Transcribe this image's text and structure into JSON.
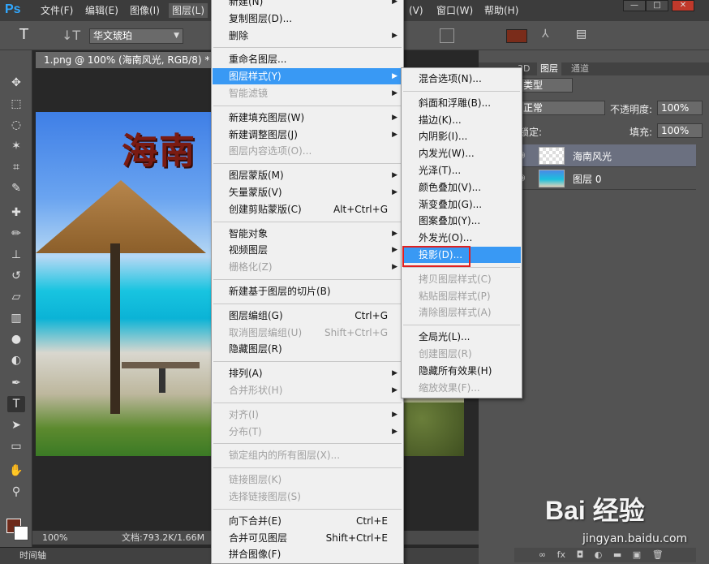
{
  "app": {
    "logo": "Ps"
  },
  "menubar": {
    "items": [
      "文件(F)",
      "编辑(E)",
      "图像(I)",
      "图层(L)",
      "(V)",
      "窗口(W)",
      "帮助(H)"
    ],
    "window_controls": [
      "—",
      "□",
      "✕"
    ]
  },
  "options": {
    "font": "华文琥珀",
    "color_swatch": "#7a2c1a"
  },
  "document": {
    "tab": "1.png @ 100% (海南风光, RGB/8) *",
    "canvas_text": "海南",
    "zoom": "100%",
    "doc_size": "文档:793.2K/1.66M"
  },
  "timeline": {
    "label": "时间轴"
  },
  "layers_panel": {
    "tabs": [
      "3D",
      "图层",
      "通道"
    ],
    "filter_type": "类型",
    "blend_mode": "正常",
    "opacity_label": "不透明度:",
    "opacity_value": "100%",
    "lock_label": "锁定:",
    "fill_label": "填充:",
    "fill_value": "100%",
    "layers": [
      {
        "name": "海南风光",
        "selected": true
      },
      {
        "name": "图层 0",
        "selected": false
      }
    ],
    "bottom_icons": [
      "∞",
      "fx",
      "◘",
      "◐",
      "▬",
      "▣",
      "🗑"
    ]
  },
  "layer_menu": {
    "items": [
      {
        "label": "新建(N)",
        "arrow": true,
        "disabled": false
      },
      {
        "label": "复制图层(D)...",
        "disabled": false
      },
      {
        "label": "删除",
        "arrow": true,
        "disabled": false
      },
      {
        "sep": true
      },
      {
        "label": "重命名图层...",
        "disabled": false
      },
      {
        "label": "图层样式(Y)",
        "arrow": true,
        "highlighted": true
      },
      {
        "label": "智能滤镜",
        "arrow": true,
        "disabled": true
      },
      {
        "sep": true
      },
      {
        "label": "新建填充图层(W)",
        "arrow": true
      },
      {
        "label": "新建调整图层(J)",
        "arrow": true
      },
      {
        "label": "图层内容选项(O)...",
        "disabled": true
      },
      {
        "sep": true
      },
      {
        "label": "图层蒙版(M)",
        "arrow": true
      },
      {
        "label": "矢量蒙版(V)",
        "arrow": true
      },
      {
        "label": "创建剪贴蒙版(C)",
        "shortcut": "Alt+Ctrl+G"
      },
      {
        "sep": true
      },
      {
        "label": "智能对象",
        "arrow": true
      },
      {
        "label": "视频图层",
        "arrow": true
      },
      {
        "label": "栅格化(Z)",
        "arrow": true,
        "disabled": true
      },
      {
        "sep": true
      },
      {
        "label": "新建基于图层的切片(B)"
      },
      {
        "sep": true
      },
      {
        "label": "图层编组(G)",
        "shortcut": "Ctrl+G"
      },
      {
        "label": "取消图层编组(U)",
        "shortcut": "Shift+Ctrl+G",
        "disabled": true
      },
      {
        "label": "隐藏图层(R)"
      },
      {
        "sep": true
      },
      {
        "label": "排列(A)",
        "arrow": true
      },
      {
        "label": "合并形状(H)",
        "arrow": true,
        "disabled": true
      },
      {
        "sep": true
      },
      {
        "label": "对齐(I)",
        "arrow": true,
        "disabled": true
      },
      {
        "label": "分布(T)",
        "arrow": true,
        "disabled": true
      },
      {
        "sep": true
      },
      {
        "label": "锁定组内的所有图层(X)...",
        "disabled": true
      },
      {
        "sep": true
      },
      {
        "label": "链接图层(K)",
        "disabled": true
      },
      {
        "label": "选择链接图层(S)",
        "disabled": true
      },
      {
        "sep": true
      },
      {
        "label": "向下合并(E)",
        "shortcut": "Ctrl+E"
      },
      {
        "label": "合并可见图层",
        "shortcut": "Shift+Ctrl+E"
      },
      {
        "label": "拼合图像(F)"
      }
    ]
  },
  "style_submenu": {
    "items": [
      {
        "label": "混合选项(N)..."
      },
      {
        "sep": true
      },
      {
        "label": "斜面和浮雕(B)..."
      },
      {
        "label": "描边(K)..."
      },
      {
        "label": "内阴影(I)..."
      },
      {
        "label": "内发光(W)..."
      },
      {
        "label": "光泽(T)..."
      },
      {
        "label": "颜色叠加(V)..."
      },
      {
        "label": "渐变叠加(G)..."
      },
      {
        "label": "图案叠加(Y)..."
      },
      {
        "label": "外发光(O)..."
      },
      {
        "label": "投影(D)...",
        "highlighted": true
      },
      {
        "sep": true
      },
      {
        "label": "拷贝图层样式(C)",
        "disabled": true
      },
      {
        "label": "粘贴图层样式(P)",
        "disabled": true
      },
      {
        "label": "清除图层样式(A)",
        "disabled": true
      },
      {
        "sep": true
      },
      {
        "label": "全局光(L)..."
      },
      {
        "label": "创建图层(R)",
        "disabled": true
      },
      {
        "label": "隐藏所有效果(H)"
      },
      {
        "label": "缩放效果(F)...",
        "disabled": true
      }
    ]
  },
  "watermark": {
    "brand": "Bai 经验",
    "url": "jingyan.baidu.com"
  }
}
